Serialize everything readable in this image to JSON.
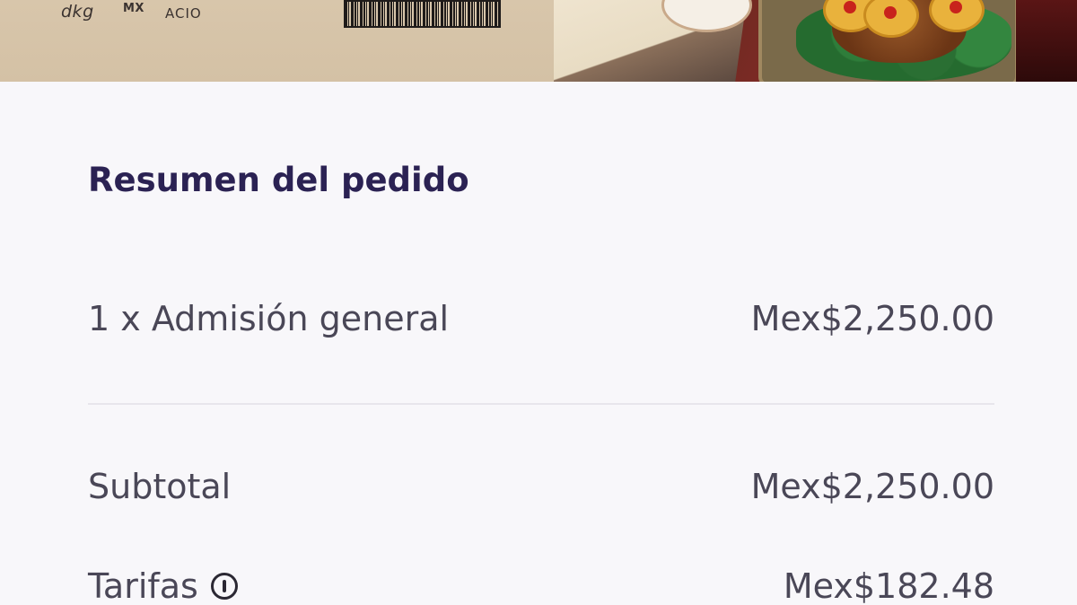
{
  "banner": {
    "sponsors": [
      "dkg",
      "MX",
      "ACIO"
    ],
    "image_description": "event promotional banner with food platter"
  },
  "order_summary": {
    "title": "Resumen del pedido",
    "line_items": [
      {
        "label": "1 x Admisión general",
        "amount": "Mex$2,250.00"
      }
    ],
    "subtotal": {
      "label": "Subtotal",
      "amount": "Mex$2,250.00"
    },
    "fees": {
      "label": "Tarifas",
      "amount": "Mex$182.48",
      "info_icon": "info-icon"
    }
  },
  "colors": {
    "background": "#f8f7fa",
    "title": "#2b2253",
    "text": "#4a4757",
    "divider": "#e8e6ec"
  }
}
